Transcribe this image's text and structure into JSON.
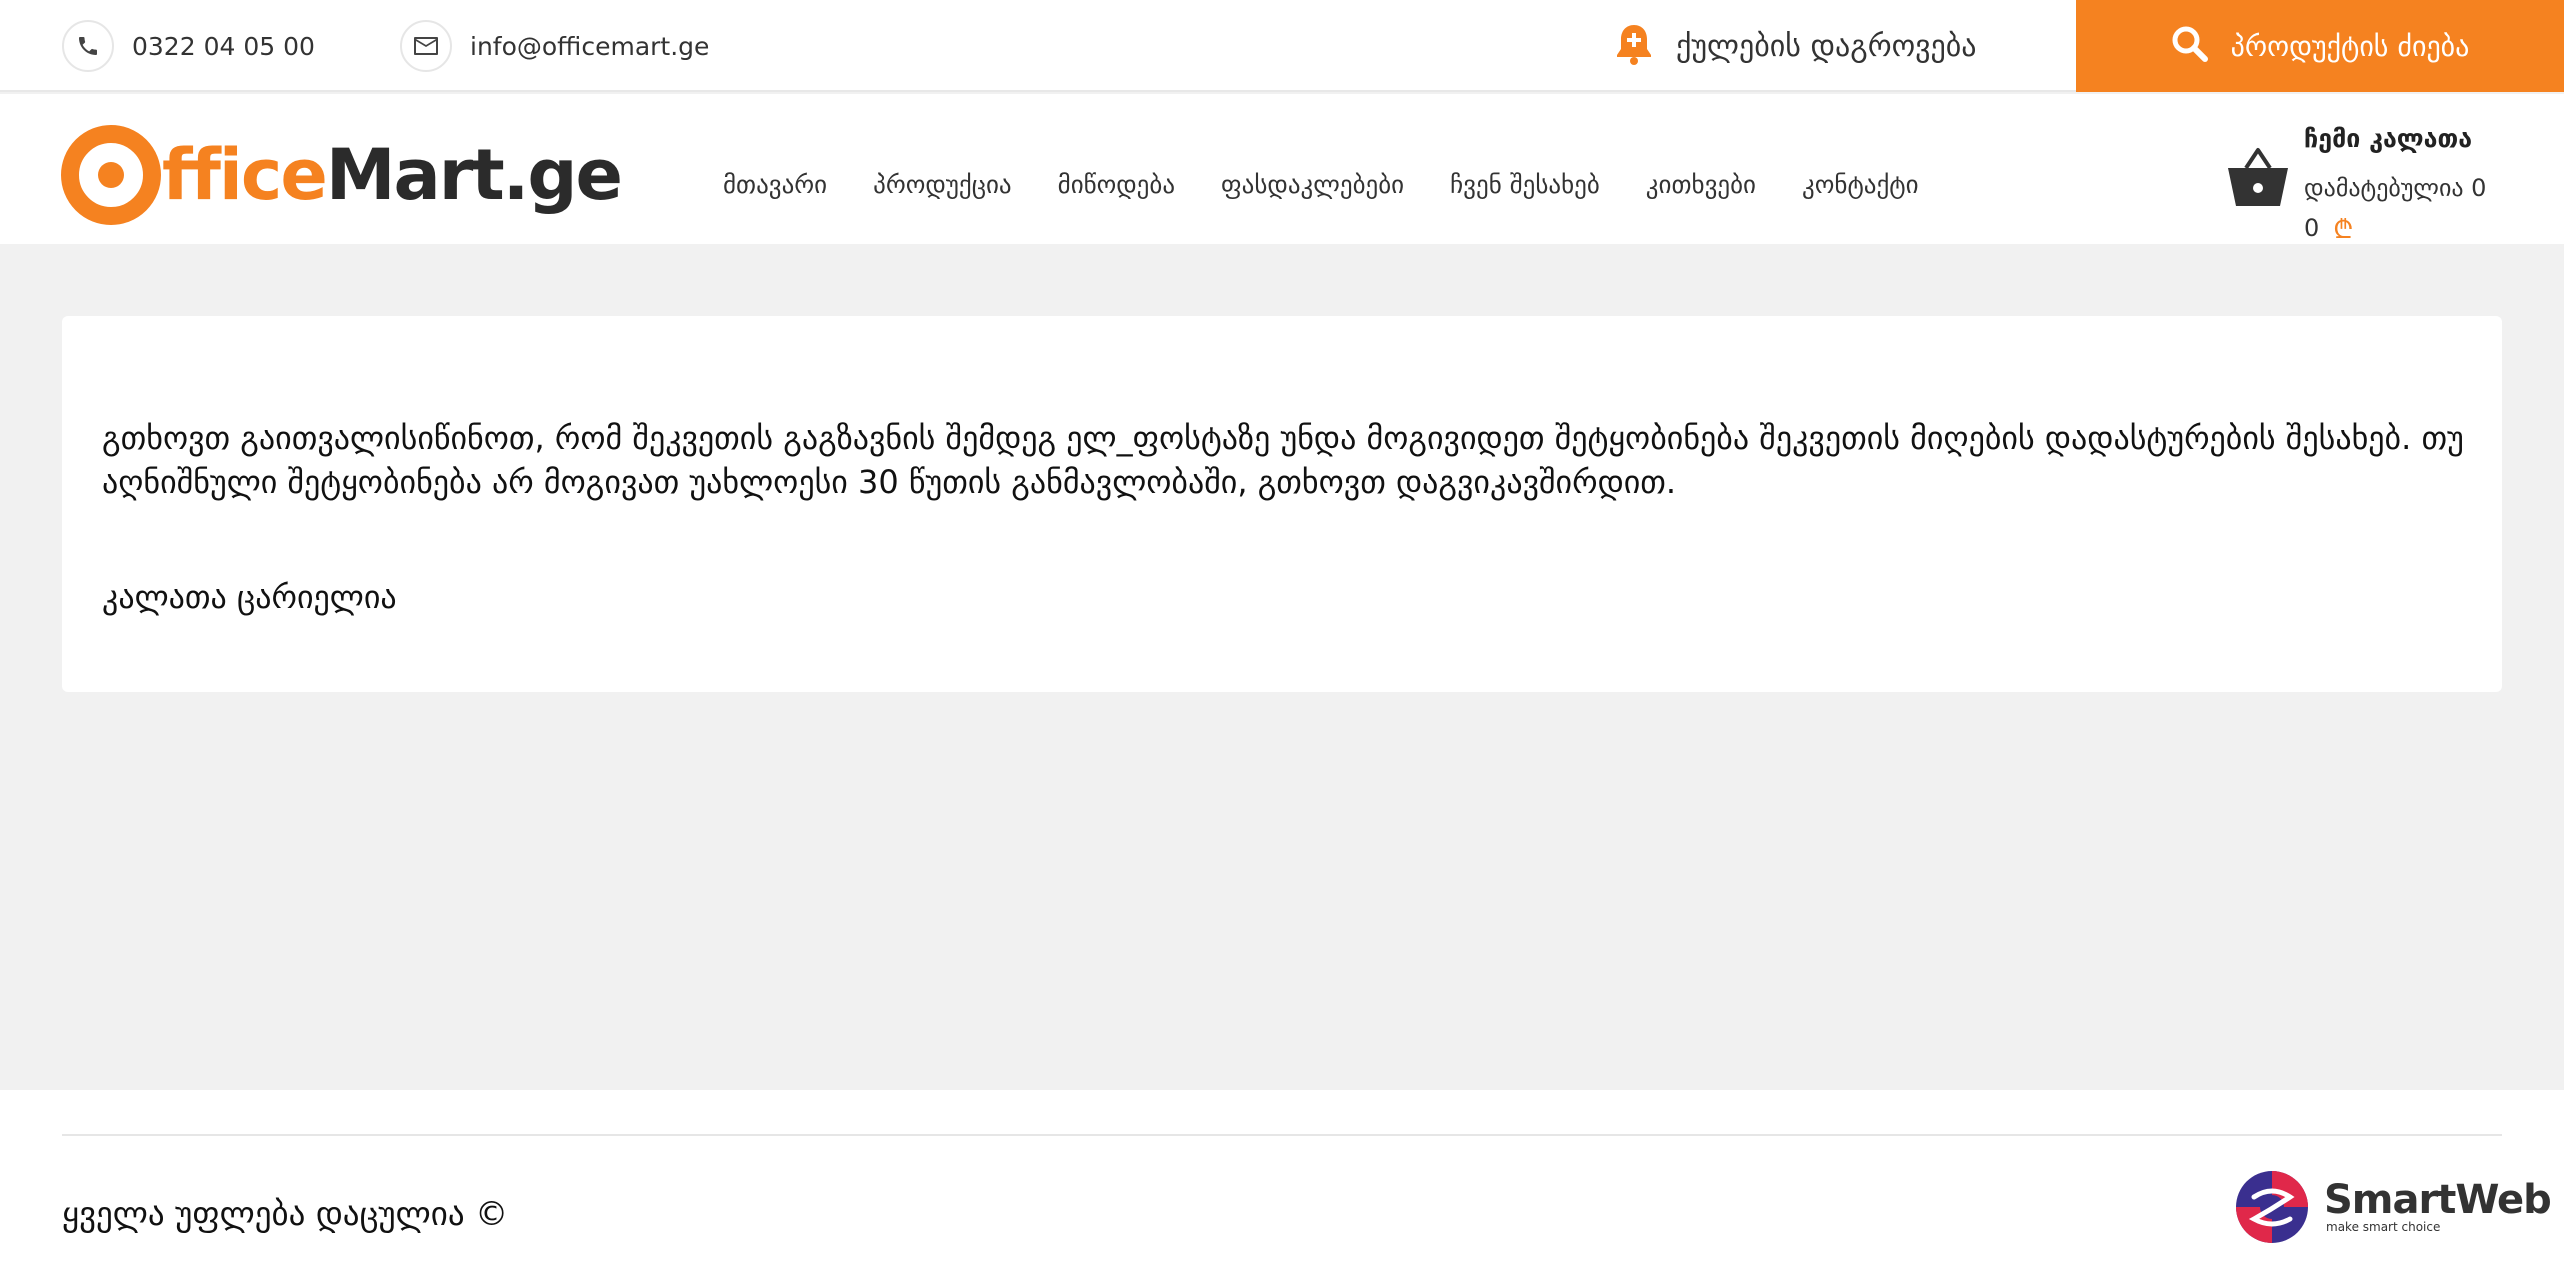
{
  "topbar": {
    "phone": "0322 04 05 00",
    "email": "info@officemart.ge",
    "bonus_label": "ქულების დაგროვება",
    "search_label": "პროდუქტის ძიება"
  },
  "logo": {
    "part1": "fficeMart.ge"
  },
  "nav": {
    "items": [
      "მთავარი",
      "პროდუქცია",
      "მიწოდება",
      "ფასდაკლებები",
      "ჩვენ შესახებ",
      "კითხვები",
      "კონტაქტი"
    ]
  },
  "cart": {
    "title": "ჩემი კალათა",
    "added_text": "დამატებულია 0",
    "total": "0",
    "currency_symbol": "₾"
  },
  "content": {
    "notice": "გთხოვთ გაითვალისიწინოთ, რომ შეკვეთის გაგზავნის შემდეგ ელ_ფოსტაზე უნდა მოგივიდეთ შეტყობინება შეკვეთის მიღების დადასტურების შესახებ. თუ აღნიშნული შეტყობინება არ მოგივათ უახლოესი 30 წუთის განმავლობაში, გთხოვთ დაგვიკავშირდით.",
    "empty_cart": "კალათა ცარიელია"
  },
  "footer": {
    "copyright": "ყველა უფლება დაცულია ©",
    "developer_name": "SmartWeb",
    "developer_tagline": "make smart choice"
  },
  "colors": {
    "accent": "#f58220",
    "page_bg": "#f1f1f1",
    "text_dark": "#2b2b2b"
  },
  "icons": {
    "phone": "phone-icon",
    "email": "envelope-icon",
    "bonus": "bell-plus-icon",
    "search": "search-icon",
    "cart": "basket-icon"
  }
}
